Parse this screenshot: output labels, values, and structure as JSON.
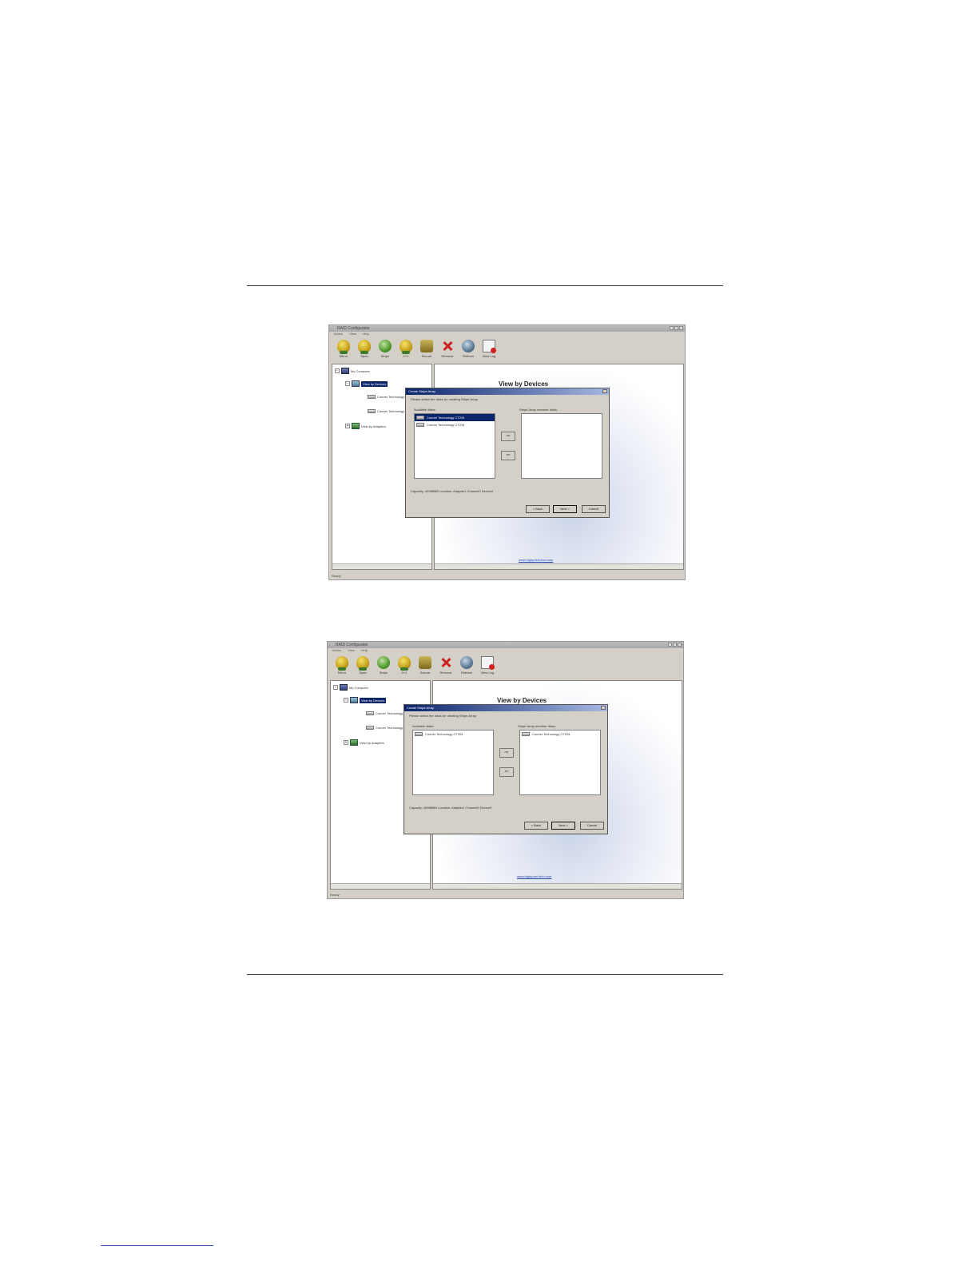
{
  "app": {
    "window_title": "RAID Configurator",
    "menu": [
      "Action",
      "View",
      "Help"
    ],
    "toolbar": [
      "Mirror",
      "Span",
      "Stripe",
      "0+1",
      "Secure",
      "Remove",
      "Refresh",
      "View Log"
    ],
    "tree": {
      "root": "My Computer",
      "view_devices": "View by Devices",
      "disk_1": "Conner Technology",
      "disk_2": "Conner Technology",
      "view_adapters": "View by Adapters"
    },
    "panel_title": "View by Devices",
    "link": "www.highpoint-tech.com",
    "status": "Ready"
  },
  "dialog": {
    "title": "Create Stripe Array",
    "instruction": "Please select the disks for creating Stripe Array",
    "available_label": "Available disks:",
    "member_label": "Stripe Array member disks:",
    "disk_name": "Conner Technology CT204",
    "capacity": "Capacity: 40988MB  Location: Adapter1 Channel0 Device0",
    "back": "< Back",
    "next": "Next >",
    "cancel": "Cancel"
  }
}
